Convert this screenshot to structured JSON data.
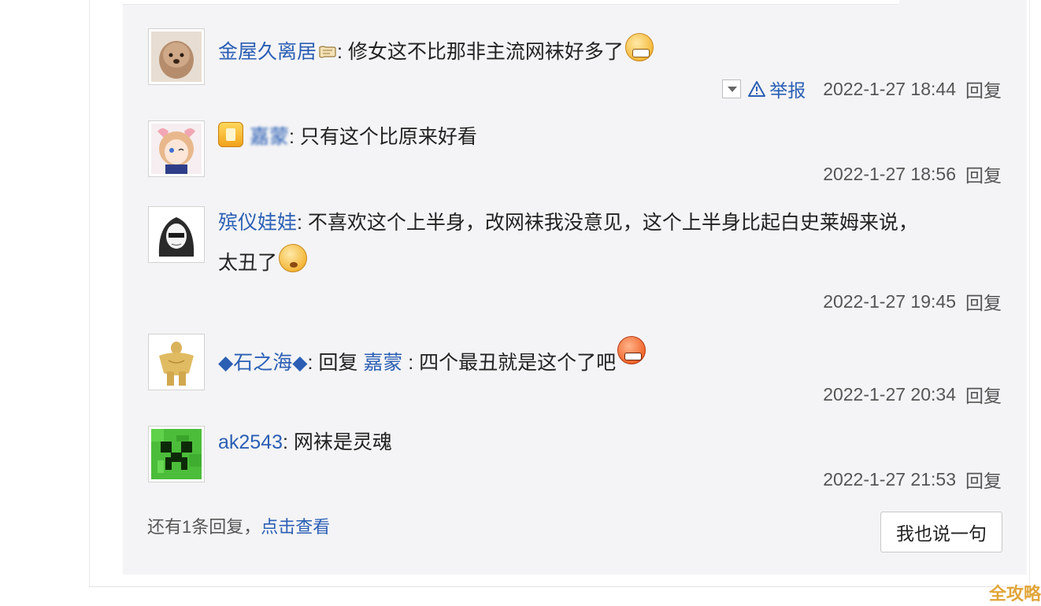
{
  "replies": [
    {
      "username": "金屋久离居",
      "colon": ":",
      "content": " 修女这不比那非主流网袜好多了",
      "timestamp": "2022-1-27 18:44",
      "reply_label": "回复",
      "report_label": "举报",
      "emoji": "grimace-emoji"
    },
    {
      "username": "嘉蒙",
      "colon": ":",
      "content": " 只有这个比原来好看",
      "timestamp": "2022-1-27 18:56",
      "reply_label": "回复"
    },
    {
      "username": "殡仪娃娃",
      "colon": ":",
      "content": " 不喜欢这个上半身，改网袜我没意见，这个上半身比起白史莱姆来说，",
      "content_line2": "太丑了",
      "timestamp": "2022-1-27 19:45",
      "reply_label": "回复",
      "emoji": "dizzy-emoji"
    },
    {
      "username": "◆石之海◆",
      "colon": ":",
      "reply_word": " 回复 ",
      "reply_to": "嘉蒙",
      "content": " : 四个最丑就是这个了吧",
      "timestamp": "2022-1-27 20:34",
      "reply_label": "回复",
      "emoji": "angry-emoji"
    },
    {
      "username": "ak2543",
      "colon": ":",
      "content": " 网袜是灵魂",
      "timestamp": "2022-1-27 21:53",
      "reply_label": "回复"
    }
  ],
  "footer": {
    "more_text": "还有1条回复，",
    "more_link": "点击查看",
    "say_button": "我也说一句"
  },
  "watermark": "全攻略",
  "colors": {
    "link": "#2b5fb4",
    "panel_bg": "#f4f4f6"
  }
}
